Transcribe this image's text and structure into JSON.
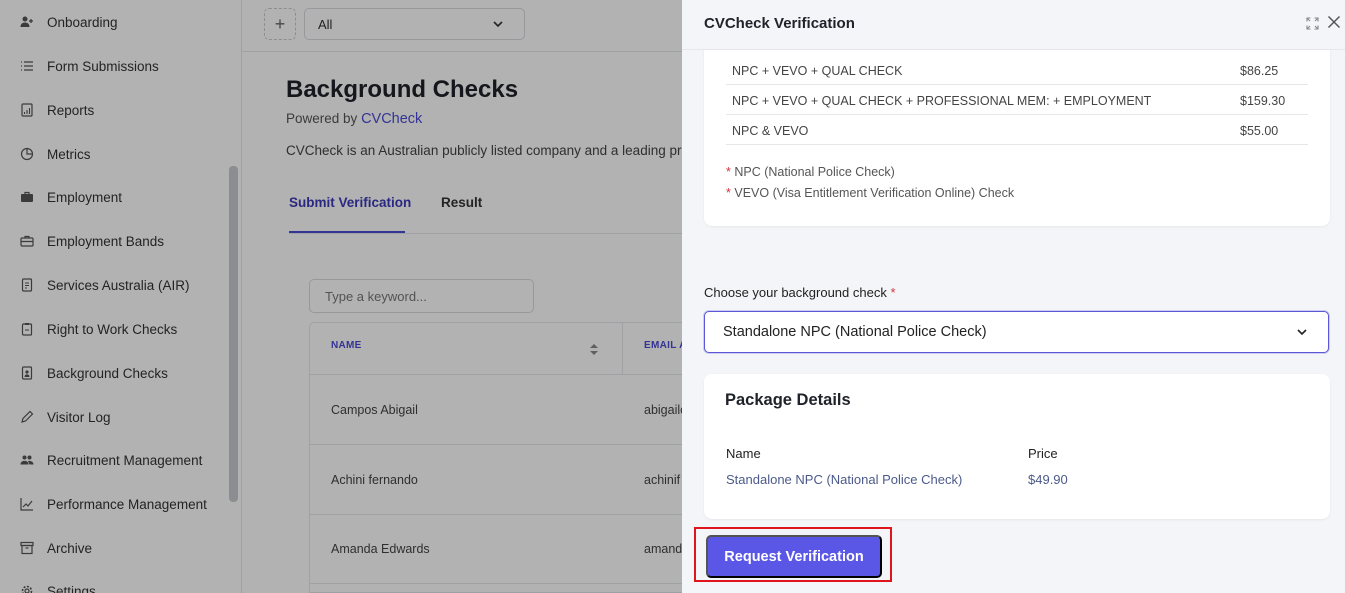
{
  "sidebar": {
    "items": [
      {
        "label": "Onboarding",
        "icon": "user-plus-icon"
      },
      {
        "label": "Form Submissions",
        "icon": "list-icon"
      },
      {
        "label": "Reports",
        "icon": "report-icon"
      },
      {
        "label": "Metrics",
        "icon": "pie-chart-icon"
      },
      {
        "label": "Employment",
        "icon": "briefcase-icon"
      },
      {
        "label": "Employment Bands",
        "icon": "briefcase-outline-icon"
      },
      {
        "label": "Services Australia (AIR)",
        "icon": "document-icon"
      },
      {
        "label": "Right to Work Checks",
        "icon": "clipboard-icon"
      },
      {
        "label": "Background Checks",
        "icon": "badge-icon"
      },
      {
        "label": "Visitor Log",
        "icon": "pen-icon"
      },
      {
        "label": "Recruitment Management",
        "icon": "users-icon"
      },
      {
        "label": "Performance Management",
        "icon": "trend-icon"
      },
      {
        "label": "Archive",
        "icon": "archive-icon"
      },
      {
        "label": "Settings",
        "icon": "gear-icon"
      }
    ]
  },
  "topbar": {
    "add_label": "+",
    "filter_value": "All"
  },
  "page": {
    "title": "Background Checks",
    "powered_prefix": "Powered by",
    "powered_link": "CVCheck",
    "description": "CVCheck is an Australian publicly listed company and a leading pro",
    "tabs": [
      "Submit Verification",
      "Result"
    ],
    "search_placeholder": "Type a keyword...",
    "table": {
      "columns": [
        "NAME",
        "EMAIL A"
      ],
      "rows": [
        {
          "name": "Campos Abigail",
          "email": "abigailc"
        },
        {
          "name": "Achini fernando",
          "email": "achinif"
        },
        {
          "name": "Amanda Edwards",
          "email": "amanda"
        }
      ]
    }
  },
  "drawer": {
    "title": "CVCheck Verification",
    "price_rows": [
      {
        "name": "NPC + VEVO + QUAL CHECK",
        "price": "$86.25"
      },
      {
        "name": "NPC + VEVO + QUAL CHECK + PROFESSIONAL MEM: + EMPLOYMENT",
        "price": "$159.30"
      },
      {
        "name": "NPC & VEVO",
        "price": "$55.00"
      }
    ],
    "notes": [
      {
        "star": "*",
        "text": "NPC (National Police Check)"
      },
      {
        "star": "*",
        "text": "VEVO (Visa Entitlement Verification Online) Check"
      }
    ],
    "choose_label": "Choose your background check",
    "required_star": "*",
    "selected_check": "Standalone NPC (National Police Check)",
    "package": {
      "title": "Package Details",
      "name_header": "Name",
      "price_header": "Price",
      "name_value": "Standalone NPC (National Police Check)",
      "price_value": "$49.90"
    },
    "request_button": "Request Verification"
  },
  "colors": {
    "accent": "#5a57e6",
    "link": "#4b4bd4",
    "highlight_border": "#e0141c",
    "required": "#d9313c"
  }
}
